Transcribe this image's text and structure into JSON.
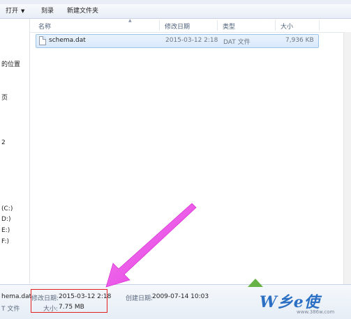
{
  "toolbar": {
    "open_label": "打开",
    "burn_label": "刻录",
    "new_folder_label": "新建文件夹"
  },
  "nav": {
    "items": [
      "的位置",
      "页",
      "2",
      "(C:)",
      "D:)",
      "E:)",
      "F:)"
    ]
  },
  "columns": {
    "name": "名称",
    "modified": "修改日期",
    "type": "类型",
    "size": "大小"
  },
  "files": [
    {
      "name": "schema.dat",
      "modified": "2015-03-12 2:18",
      "type": "DAT 文件",
      "size": "7,936 KB"
    }
  ],
  "details": {
    "file_name": "hema.dat",
    "file_type": "T 文件",
    "modified_label": "修改日期:",
    "modified_value": "2015-03-12 2:18",
    "size_label": "大小:",
    "size_value": "7.75 MB",
    "created_label": "创建日期:",
    "created_value": "2009-07-14 10:03"
  },
  "watermark": {
    "logo_text": "W乡e使",
    "url": "www.386w.com"
  },
  "colors": {
    "selection_fill": "#d9e9fb",
    "selection_border": "#9ec3ea",
    "highlight_box": "#e21f1f",
    "annotation_arrow": "#e62fe0"
  },
  "icons": {
    "file": "document-icon",
    "annotation": "arrow-annotation"
  }
}
